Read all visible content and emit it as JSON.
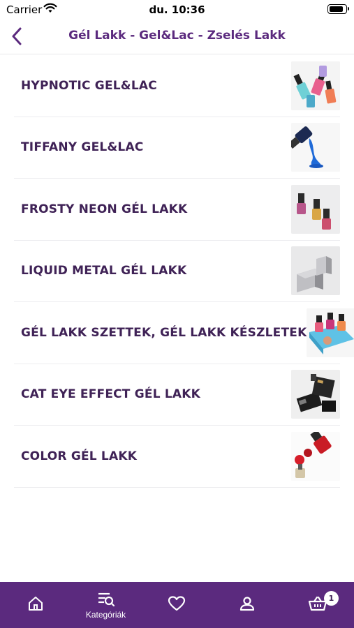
{
  "status_bar": {
    "carrier": "Carrier",
    "time": "du. 10:36",
    "battery_level": 0.9
  },
  "nav": {
    "title": "Gél Lakk - Gel&Lac - Zselés Lakk",
    "back_icon": "chevron-left-icon"
  },
  "categories": [
    {
      "label": "HYPNOTIC GEL&LAC",
      "thumb": "nail-polish-bottles-image"
    },
    {
      "label": "TIFFANY GEL&LAC",
      "thumb": "blue-polish-pour-image"
    },
    {
      "label": "FROSTY NEON GÉL LAKK",
      "thumb": "neon-polish-bottles-image"
    },
    {
      "label": "LIQUID METAL GÉL LAKK",
      "thumb": "metal-cube-image"
    },
    {
      "label": "GÉL LAKK SZETTEK, GÉL LAKK KÉSZLETEK",
      "thumb": "polish-set-box-image"
    },
    {
      "label": "CAT EYE EFFECT GÉL LAKK",
      "thumb": "cat-eye-boxes-image"
    },
    {
      "label": "COLOR GÉL LAKK",
      "thumb": "red-polish-image"
    }
  ],
  "tab_bar": {
    "tabs": [
      {
        "icon": "home-icon",
        "label": ""
      },
      {
        "icon": "category-search-icon",
        "label": "Kategóriák"
      },
      {
        "icon": "heart-icon",
        "label": ""
      },
      {
        "icon": "user-icon",
        "label": ""
      },
      {
        "icon": "cart-icon",
        "label": ""
      }
    ],
    "cart_count": "1",
    "active_index": 1
  },
  "colors": {
    "brand": "#5b2a7e",
    "text": "#3f2256",
    "divider": "#ececef"
  }
}
